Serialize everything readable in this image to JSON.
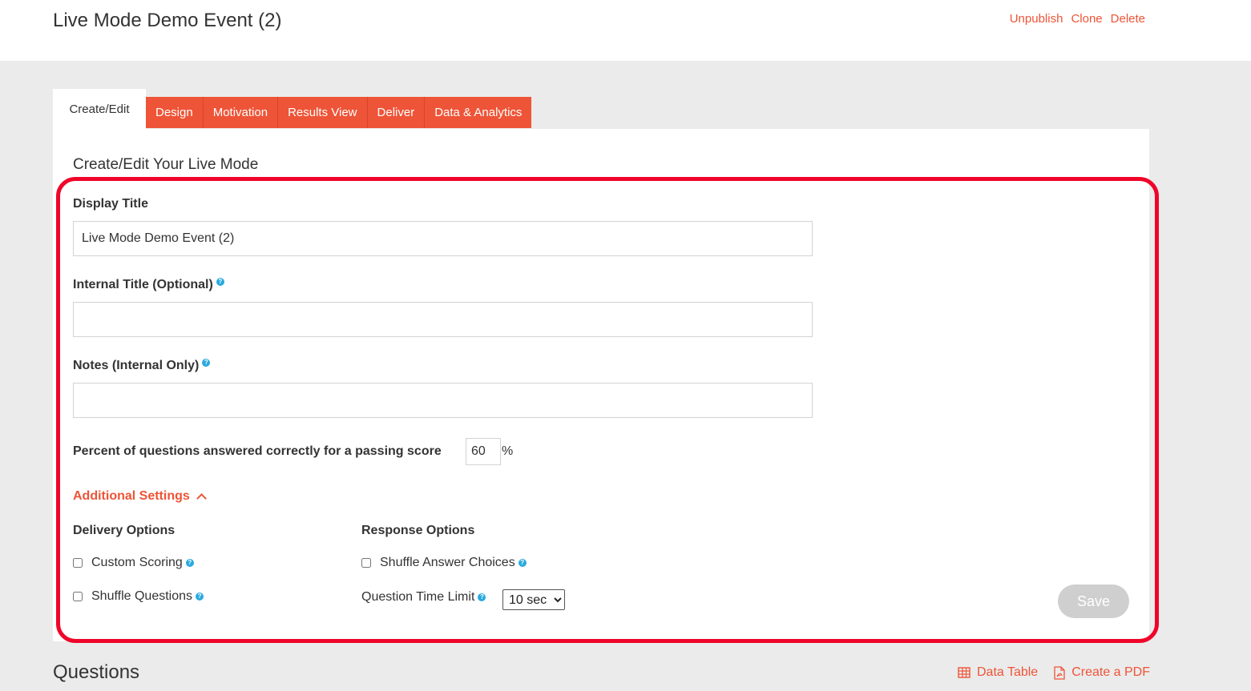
{
  "header": {
    "title": "Live Mode Demo Event (2)",
    "actions": {
      "unpublish": "Unpublish",
      "clone": "Clone",
      "delete": "Delete"
    }
  },
  "tabs": {
    "active": "Create/Edit",
    "items": [
      "Design",
      "Motivation",
      "Results View",
      "Deliver",
      "Data & Analytics"
    ]
  },
  "form": {
    "heading": "Create/Edit Your Live Mode",
    "display_title_label": "Display Title",
    "display_title_value": "Live Mode Demo Event (2)",
    "internal_title_label": "Internal Title (Optional)",
    "internal_title_value": "",
    "notes_label": "Notes (Internal Only)",
    "notes_value": "",
    "passing_label": "Percent of questions answered correctly for a passing score",
    "passing_value": "60",
    "passing_unit": "%",
    "additional_settings": "Additional Settings",
    "delivery_options": {
      "title": "Delivery Options",
      "custom_scoring": "Custom Scoring",
      "shuffle_questions": "Shuffle Questions"
    },
    "response_options": {
      "title": "Response Options",
      "shuffle_answers": "Shuffle Answer Choices",
      "time_limit_label": "Question Time Limit",
      "time_limit_value": "10 sec"
    },
    "save_label": "Save"
  },
  "questions": {
    "title": "Questions",
    "data_table": "Data Table",
    "create_pdf": "Create a PDF"
  },
  "colors": {
    "accent": "#ee5437",
    "highlight": "#f0052a",
    "help": "#29a9df"
  }
}
